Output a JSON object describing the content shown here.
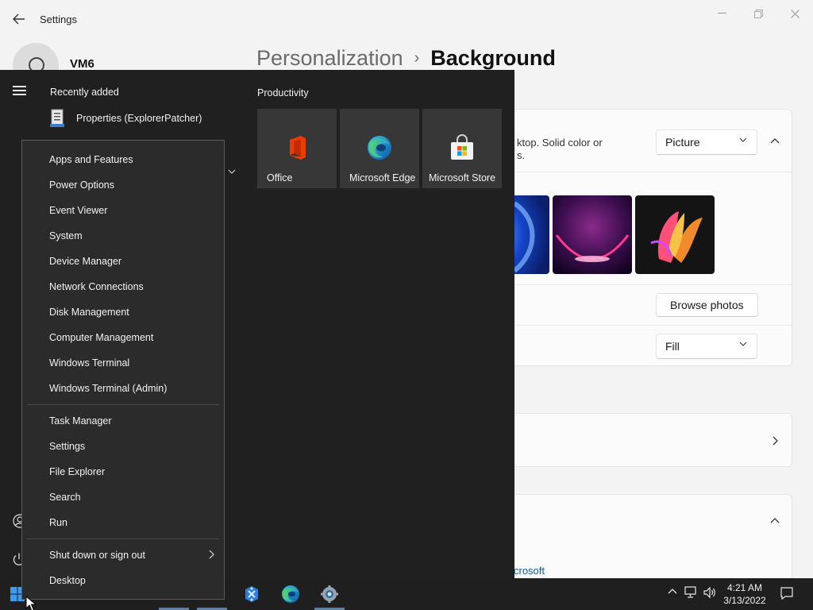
{
  "settings": {
    "title": "Settings",
    "user_name": "VM6",
    "breadcrumb_parent": "Personalization",
    "breadcrumb_separator": "›",
    "breadcrumb_current": "Background",
    "background_desc_line1": "ktop. Solid color or",
    "background_desc_line2": "s.",
    "background_type_value": "Picture",
    "browse_photos_label": "Browse photos",
    "fit_value": "Fill",
    "partial_link": "crosoft"
  },
  "start_menu": {
    "recently_added_title": "Recently added",
    "recent_items": [
      {
        "label": "Properties (ExplorerPatcher)",
        "icon": "properties-icon"
      }
    ],
    "productivity_title": "Productivity",
    "tiles": [
      {
        "label": "Office",
        "icon": "office-icon"
      },
      {
        "label": "Microsoft Edge",
        "icon": "edge-icon"
      },
      {
        "label": "Microsoft Store",
        "icon": "store-icon"
      }
    ]
  },
  "context_menu": {
    "items": [
      "Apps and Features",
      "Power Options",
      "Event Viewer",
      "System",
      "Device Manager",
      "Network Connections",
      "Disk Management",
      "Computer Management",
      "Windows Terminal",
      "Windows Terminal (Admin)",
      "Task Manager",
      "Settings",
      "File Explorer",
      "Search",
      "Run",
      "Shut down or sign out",
      "Desktop"
    ]
  },
  "taskbar": {
    "time": "4:21 AM",
    "date": "3/13/2022"
  },
  "colors": {
    "start_bg": "#202020",
    "menu_bg": "#2b2b2b",
    "tile_bg": "#373737",
    "accent_link": "#0f5ca8",
    "taskbar_bg": "#1f1f1f"
  }
}
